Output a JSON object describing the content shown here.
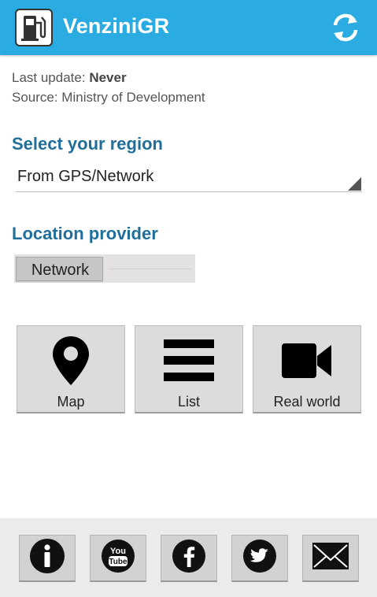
{
  "app": {
    "title": "VenziniGR"
  },
  "status": {
    "last_update_label": "Last update:",
    "last_update_value": "Never",
    "source": "Source: Ministry of Development"
  },
  "region": {
    "heading": "Select your region",
    "selected": "From GPS/Network"
  },
  "provider": {
    "heading": "Location provider",
    "selected": "Network"
  },
  "actions": [
    {
      "label": "Map",
      "icon": "map-pin-icon"
    },
    {
      "label": "List",
      "icon": "list-icon"
    },
    {
      "label": "Real world",
      "icon": "video-camera-icon"
    }
  ],
  "footer": [
    {
      "icon": "info-icon"
    },
    {
      "icon": "youtube-icon"
    },
    {
      "icon": "facebook-icon"
    },
    {
      "icon": "twitter-icon"
    },
    {
      "icon": "mail-icon"
    }
  ],
  "colors": {
    "action_bar": "#2aace2",
    "heading": "#1f6f9a"
  }
}
